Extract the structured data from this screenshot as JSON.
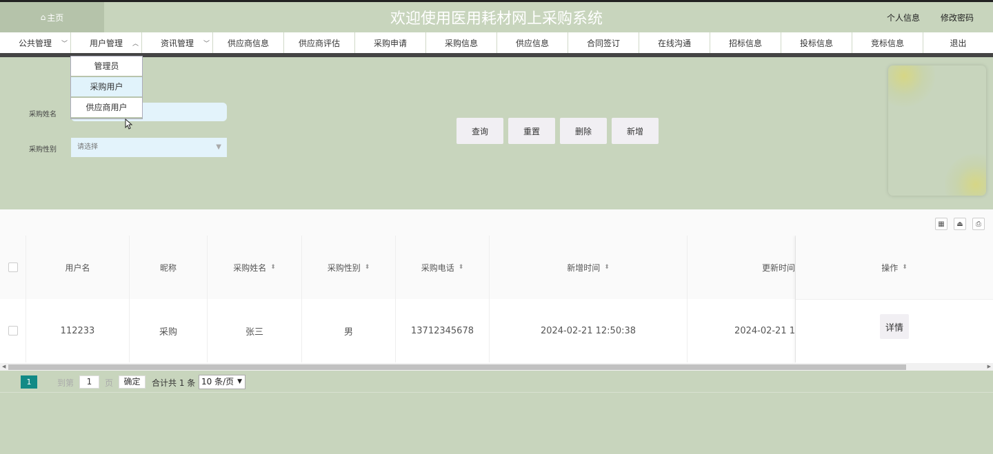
{
  "header": {
    "home_icon": "home-icon",
    "home_label": "主页",
    "title": "欢迎使用医用耗材网上采购系统",
    "profile_link": "个人信息",
    "password_link": "修改密码"
  },
  "nav": {
    "items": [
      {
        "label": "公共管理",
        "chevron": "﹀"
      },
      {
        "label": "用户管理",
        "chevron": "︿"
      },
      {
        "label": "资讯管理",
        "chevron": "﹀"
      },
      {
        "label": "供应商信息"
      },
      {
        "label": "供应商评估"
      },
      {
        "label": "采购申请"
      },
      {
        "label": "采购信息"
      },
      {
        "label": "供应信息"
      },
      {
        "label": "合同签订"
      },
      {
        "label": "在线沟通"
      },
      {
        "label": "招标信息"
      },
      {
        "label": "投标信息"
      },
      {
        "label": "竞标信息"
      },
      {
        "label": "退出"
      }
    ],
    "dropdown": [
      "管理员",
      "采购用户",
      "供应商用户"
    ]
  },
  "search": {
    "name_label": "采购姓名",
    "name_value": "",
    "gender_label": "采购性别",
    "gender_placeholder": "请选择",
    "buttons": {
      "query": "查询",
      "reset": "重置",
      "delete": "删除",
      "add": "新增"
    }
  },
  "table": {
    "columns": [
      "用户名",
      "昵称",
      "采购姓名",
      "采购性别",
      "采购电话",
      "新增时间",
      "更新时间",
      "操作"
    ],
    "rows": [
      {
        "username": "112233",
        "nickname": "采购",
        "name": "张三",
        "gender": "男",
        "phone": "13712345678",
        "created": "2024-02-21 12:50:38",
        "updated": "2024-02-21 1",
        "action": "详情"
      }
    ]
  },
  "pager": {
    "current": "1",
    "goto_label": "到第",
    "goto_value": "1",
    "page_unit": "页",
    "confirm": "确定",
    "total": "合计共 1 条",
    "page_size": "10 条/页"
  },
  "colors": {
    "background": "#c8d5bd",
    "pager_active": "#128a86",
    "input_bg": "#e3f3fb"
  }
}
